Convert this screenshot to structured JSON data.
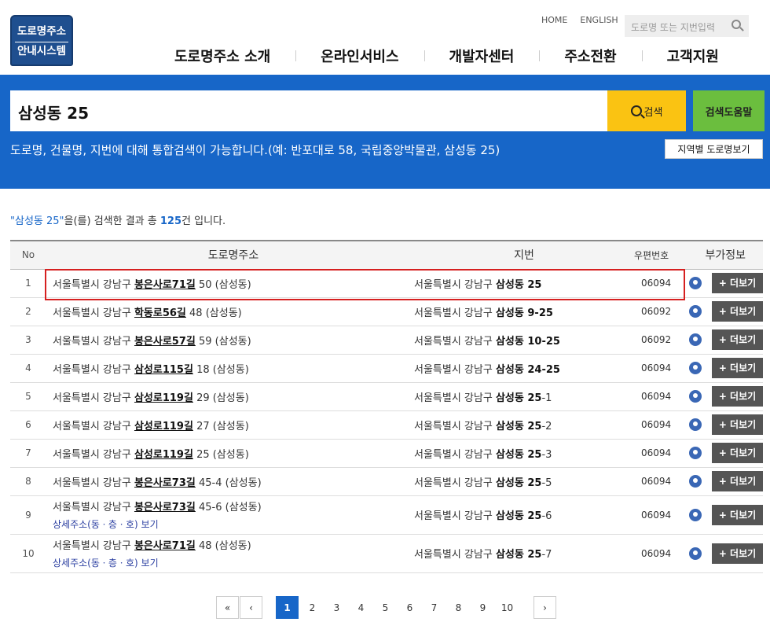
{
  "logo": {
    "line1": "도로명주소",
    "line2": "안내시스템"
  },
  "util": {
    "home": "HOME",
    "english": "ENGLISH",
    "search_placeholder": "도로명 또는 지번입력"
  },
  "gnb": [
    "도로명주소 소개",
    "온라인서비스",
    "개발자센터",
    "주소전환",
    "고객지원"
  ],
  "search": {
    "value": "삼성동 25",
    "button": "검색",
    "help_button": "검색도움말",
    "notice": "도로명, 건물명, 지번에 대해 통합검색이 가능합니다.(예: 반포대로 58, 국립중앙박물관, 삼성동 25)",
    "region_button": "지역별 도로명보기"
  },
  "summary": {
    "query": "\"삼성동 25\"",
    "mid": "을(를) 검색한 결과 총 ",
    "count": "125",
    "tail": "건 입니다."
  },
  "table": {
    "headers": [
      "No",
      "도로명주소",
      "지번",
      "우편번호",
      "부가정보"
    ],
    "more_label": "+ 더보기",
    "detail_label": "상세주소(동ㆍ층ㆍ호) 보기",
    "rows": [
      {
        "no": "1",
        "pre": "서울특별시 강남구 ",
        "road": "봉은사로71길",
        "post": " 50 (삼성동)",
        "jib_pre": "서울특별시 강남구 ",
        "dong": "삼성동",
        "num_a": " 25",
        "num_b": "",
        "zip": "06094"
      },
      {
        "no": "2",
        "pre": "서울특별시 강남구 ",
        "road": "학동로56길",
        "post": " 48 (삼성동)",
        "jib_pre": "서울특별시 강남구 ",
        "dong": "삼성동",
        "num_a": " 9-",
        "num_b": "25",
        "zip": "06092"
      },
      {
        "no": "3",
        "pre": "서울특별시 강남구 ",
        "road": "봉은사로57길",
        "post": " 59 (삼성동)",
        "jib_pre": "서울특별시 강남구 ",
        "dong": "삼성동",
        "num_a": " 10-",
        "num_b": "25",
        "zip": "06092"
      },
      {
        "no": "4",
        "pre": "서울특별시 강남구 ",
        "road": "삼성로115길",
        "post": " 18 (삼성동)",
        "jib_pre": "서울특별시 강남구 ",
        "dong": "삼성동",
        "num_a": " 24-",
        "num_b": "25",
        "zip": "06094"
      },
      {
        "no": "5",
        "pre": "서울특별시 강남구 ",
        "road": "삼성로119길",
        "post": " 29 (삼성동)",
        "jib_pre": "서울특별시 강남구 ",
        "dong": "삼성동",
        "num_a": " 25",
        "num_b": "-1",
        "zip": "06094"
      },
      {
        "no": "6",
        "pre": "서울특별시 강남구 ",
        "road": "삼성로119길",
        "post": " 27 (삼성동)",
        "jib_pre": "서울특별시 강남구 ",
        "dong": "삼성동",
        "num_a": " 25",
        "num_b": "-2",
        "zip": "06094"
      },
      {
        "no": "7",
        "pre": "서울특별시 강남구 ",
        "road": "삼성로119길",
        "post": " 25 (삼성동)",
        "jib_pre": "서울특별시 강남구 ",
        "dong": "삼성동",
        "num_a": " 25",
        "num_b": "-3",
        "zip": "06094"
      },
      {
        "no": "8",
        "pre": "서울특별시 강남구 ",
        "road": "봉은사로73길",
        "post": " 45-4 (삼성동)",
        "jib_pre": "서울특별시 강남구 ",
        "dong": "삼성동",
        "num_a": " 25",
        "num_b": "-5",
        "zip": "06094"
      },
      {
        "no": "9",
        "pre": "서울특별시 강남구 ",
        "road": "봉은사로73길",
        "post": " 45-6 (삼성동)",
        "jib_pre": "서울특별시 강남구 ",
        "dong": "삼성동",
        "num_a": " 25",
        "num_b": "-6",
        "zip": "06094",
        "detail": true
      },
      {
        "no": "10",
        "pre": "서울특별시 강남구 ",
        "road": "봉은사로71길",
        "post": " 48 (삼성동)",
        "jib_pre": "서울특별시 강남구 ",
        "dong": "삼성동",
        "num_a": " 25",
        "num_b": "-7",
        "zip": "06094",
        "detail": true
      }
    ]
  },
  "pager": {
    "first": "«",
    "prev": "‹",
    "next": "›",
    "pages": [
      "1",
      "2",
      "3",
      "4",
      "5",
      "6",
      "7",
      "8",
      "9",
      "10"
    ],
    "active": "1"
  }
}
